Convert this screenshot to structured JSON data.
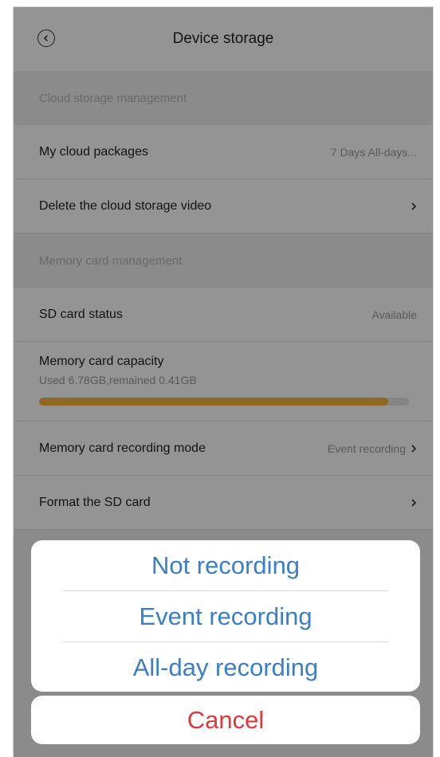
{
  "header": {
    "title": "Device storage"
  },
  "cloud": {
    "section_title": "Cloud storage management",
    "packages_label": "My cloud packages",
    "packages_value": "7 Days All-days...",
    "delete_label": "Delete the cloud storage video"
  },
  "memory": {
    "section_title": "Memory card management",
    "sd_status_label": "SD card status",
    "sd_status_value": "Available",
    "capacity_label": "Memory card capacity",
    "capacity_detail": "Used 6.78GB,remained 0.41GB",
    "capacity_used_fraction": 0.943,
    "recording_mode_label": "Memory card recording mode",
    "recording_mode_value": "Event recording",
    "format_label": "Format the SD card"
  },
  "action_sheet": {
    "options": [
      "Not recording",
      "Event recording",
      "All-day recording"
    ],
    "cancel": "Cancel"
  },
  "colors": {
    "progress": "#f1b43c",
    "option_text": "#3b7fc6",
    "cancel_text": "#e0393b"
  },
  "icons": {
    "back": "back-circle-icon",
    "chevron": "chevron-right-icon"
  }
}
